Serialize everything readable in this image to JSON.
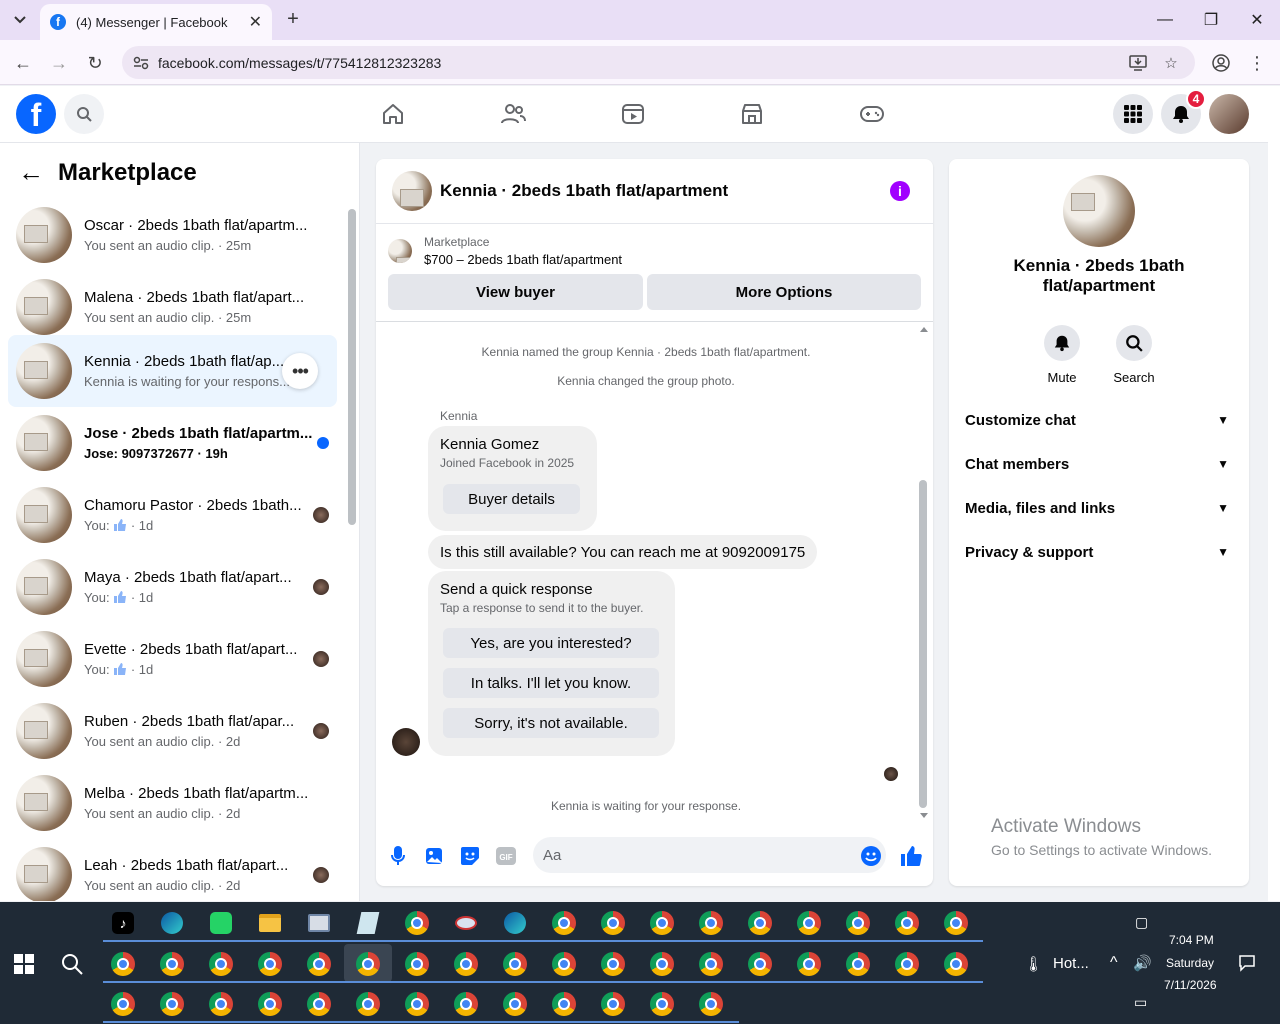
{
  "browser": {
    "tab_title": "(4) Messenger | Facebook",
    "url": "facebook.com/messages/t/775412812323283"
  },
  "topbar": {
    "notification_count": "4",
    "logo_letter": "f"
  },
  "sidebar": {
    "title": "Marketplace",
    "conversations": [
      {
        "name": "Oscar · 2beds 1bath flat/apartm...",
        "sub": "You sent an audio clip. · 25m"
      },
      {
        "name": "Malena · 2beds 1bath flat/apart...",
        "sub": "You sent an audio clip. · 25m"
      },
      {
        "name": "Kennia · 2beds 1bath flat/ap...",
        "sub": "Kennia is waiting for your respons..."
      },
      {
        "name": "Jose · 2beds 1bath flat/apartm...",
        "sub": "Jose: 9097372677 · 19h"
      },
      {
        "name": "Chamoru Pastor · 2beds 1bath...",
        "sub_prefix": "You:",
        "sub": "· 1d"
      },
      {
        "name": "Maya · 2beds 1bath flat/apart...",
        "sub_prefix": "You:",
        "sub": "· 1d"
      },
      {
        "name": "Evette · 2beds 1bath flat/apart...",
        "sub_prefix": "You:",
        "sub": "· 1d"
      },
      {
        "name": "Ruben · 2beds 1bath flat/apar...",
        "sub": "You sent an audio clip. · 2d"
      },
      {
        "name": "Melba · 2beds 1bath flat/apartm...",
        "sub": "You sent an audio clip. · 2d"
      },
      {
        "name": "Leah · 2beds 1bath flat/apart...",
        "sub": "You sent an audio clip. · 2d"
      }
    ]
  },
  "chat": {
    "title": "Kennia · 2beds 1bath flat/apartment",
    "marketplace_label": "Marketplace",
    "listing": "$700 – 2beds 1bath flat/apartment",
    "view_buyer": "View buyer",
    "more_options": "More Options",
    "system_1": "Kennia named the group Kennia · 2beds 1bath flat/apartment.",
    "system_2": "Kennia changed the group photo.",
    "sender": "Kennia",
    "card_name": "Kennia Gomez",
    "card_sub": "Joined Facebook in 2025",
    "card_button": "Buyer details",
    "message": "Is this still available? You can reach me at 9092009175",
    "quick_title": "Send a quick response",
    "quick_sub": "Tap a response to send it to the buyer.",
    "quick_1": "Yes, are you interested?",
    "quick_2": "In talks. I'll let you know.",
    "quick_3": "Sorry, it's not available.",
    "waiting": "Kennia is waiting for your response.",
    "composer_placeholder": "Aa"
  },
  "right_panel": {
    "name": "Kennia · 2beds 1bath flat/apartment",
    "mute": "Mute",
    "search": "Search",
    "sections": [
      "Customize chat",
      "Chat members",
      "Media, files and links",
      "Privacy & support"
    ]
  },
  "watermark": {
    "line1": "Activate Windows",
    "line2": "Go to Settings to activate Windows."
  },
  "taskbar": {
    "weather": "Hot...",
    "time": "7:04 PM",
    "day": "Saturday",
    "date": "7/11/2026"
  }
}
